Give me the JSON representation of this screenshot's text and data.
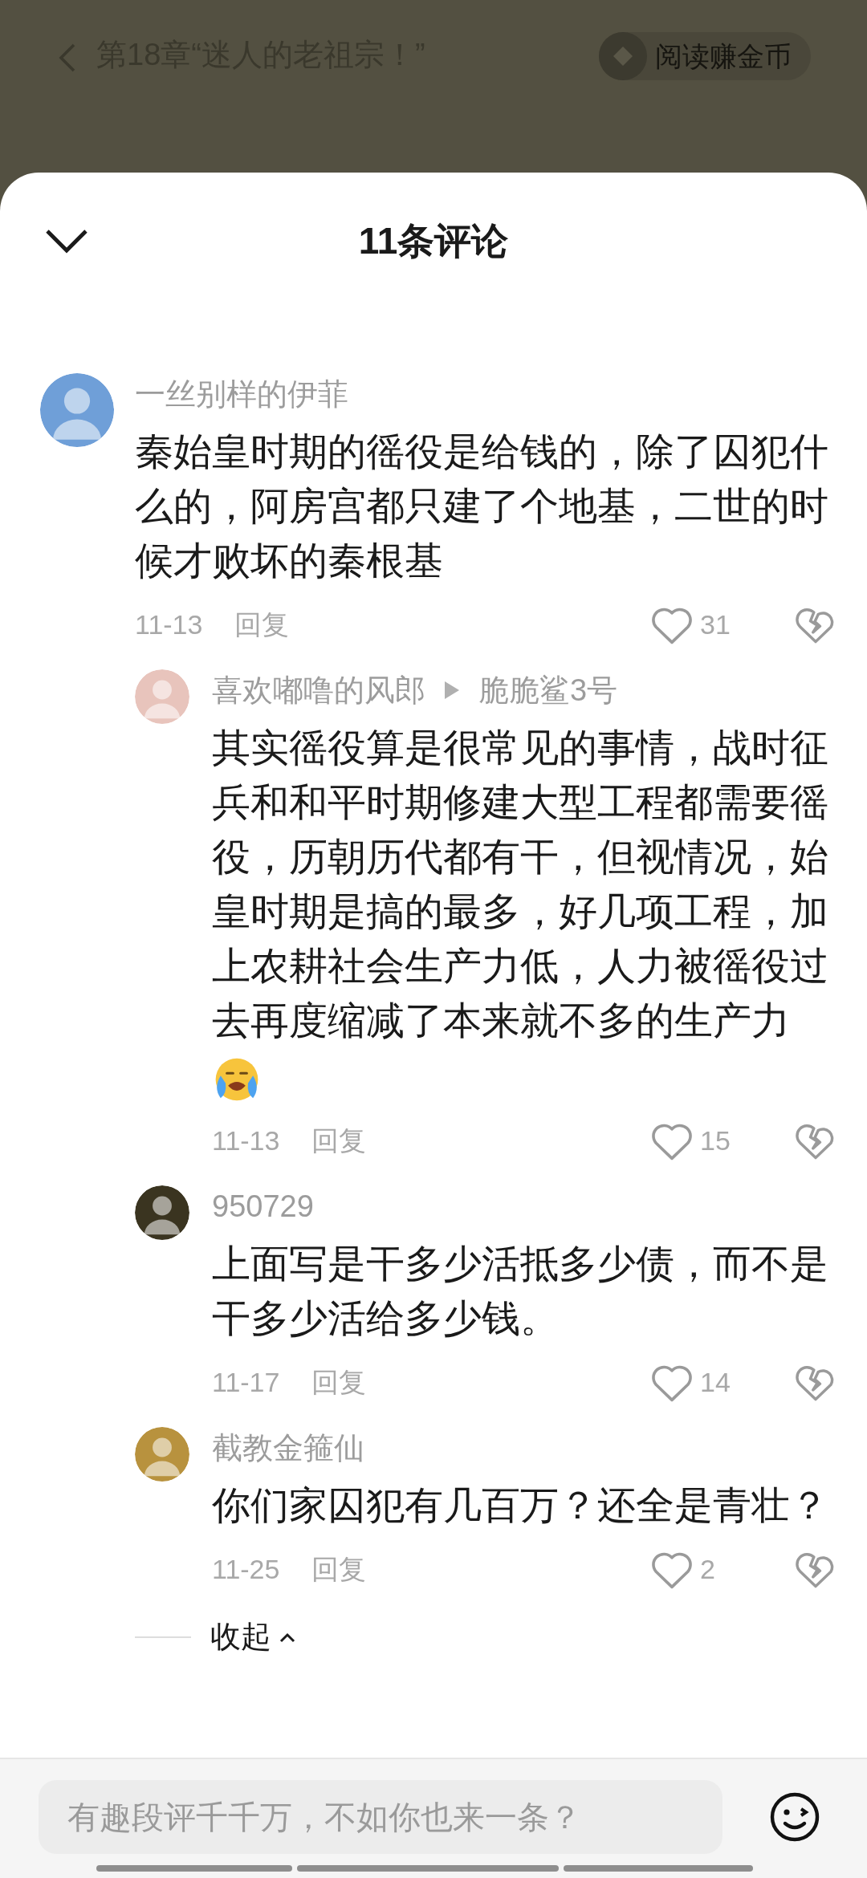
{
  "reader_header": {
    "chapter_title": "第18章“迷人的老祖宗！”",
    "coin_button": "阅读赚金币"
  },
  "sheet": {
    "title": "11条评论"
  },
  "comments": [
    {
      "author": "一丝别样的伊菲",
      "avatar": {
        "color": "#6f9fd8"
      },
      "text": "秦始皇时期的徭役是给钱的，除了囚犯什么的，阿房宫都只建了个地基，二世的时候才败坏的秦根基",
      "date": "11-13",
      "reply": "回复",
      "likes": "31",
      "replies": [
        {
          "author": "喜欢嘟噜的风郎",
          "reply_to": "脆脆鲨3号",
          "avatar": {
            "color": "#e8c4bc"
          },
          "text": "其实徭役算是很常见的事情，战时征兵和和平时期修建大型工程都需要徭役，历朝历代都有干，但视情况，始皇时期是搞的最多，好几项工程，加上农耕社会生产力低，人力被徭役过去再度缩减了本来就不多的生产力",
          "has_emoji": true,
          "date": "11-13",
          "reply": "回复",
          "likes": "15"
        },
        {
          "author": "950729",
          "avatar": {
            "color": "#3a3420"
          },
          "text": "上面写是干多少活抵多少债，而不是干多少活给多少钱。",
          "has_emoji": false,
          "date": "11-17",
          "reply": "回复",
          "likes": "14"
        },
        {
          "author": "截教金箍仙",
          "avatar": {
            "color": "#b8923e"
          },
          "text": "你们家囚犯有几百万？还全是青壮？",
          "has_emoji": false,
          "date": "11-25",
          "reply": "回复",
          "likes": "2"
        }
      ],
      "collapse": "收起"
    }
  ],
  "composer": {
    "placeholder": "有趣段评千千万，不如你也来一条？"
  }
}
